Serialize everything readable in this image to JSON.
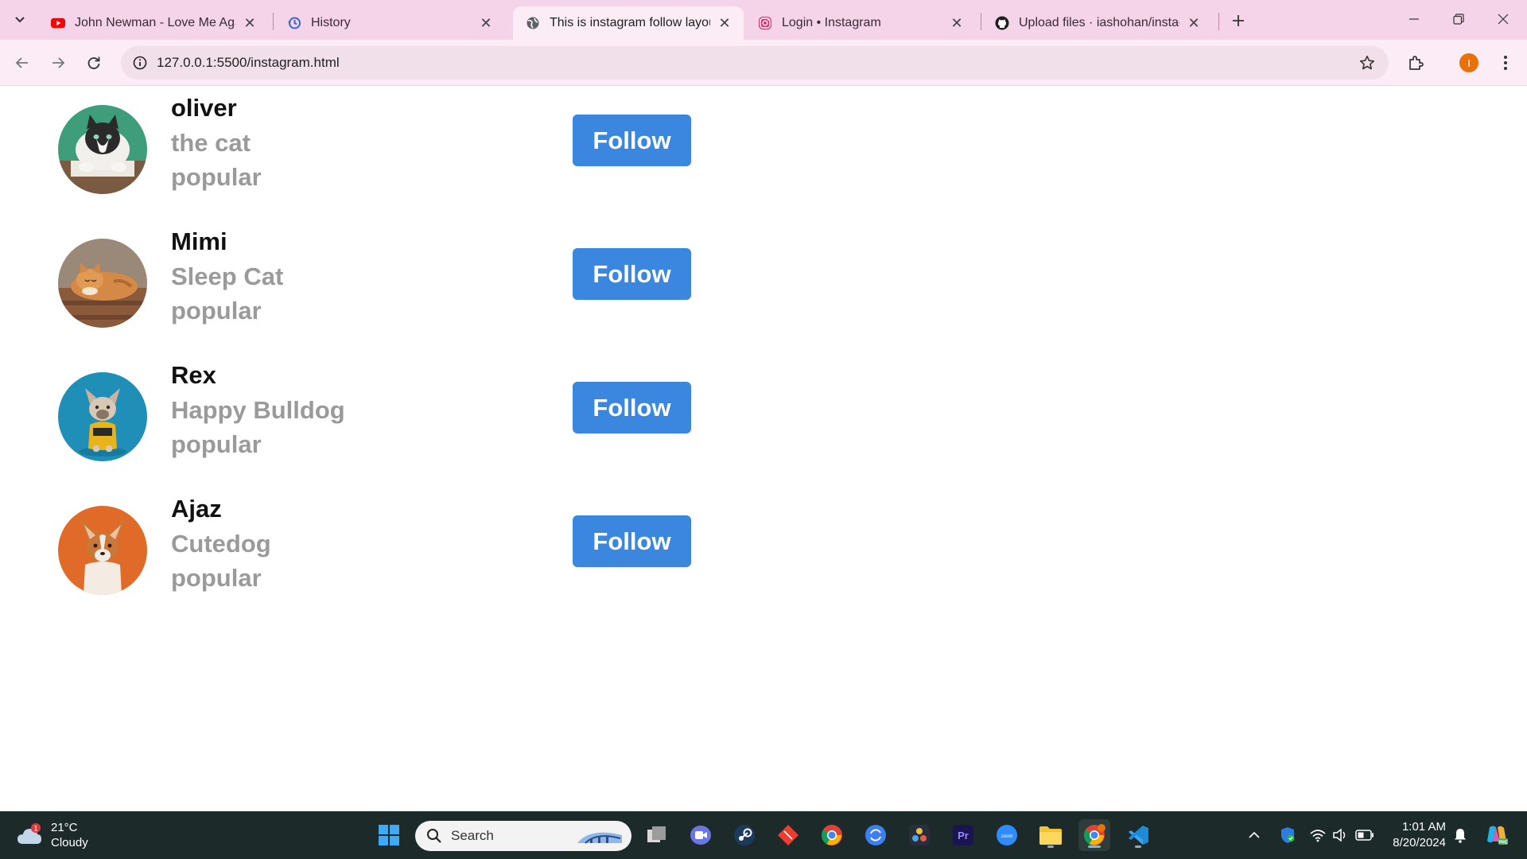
{
  "browser": {
    "tabs": [
      {
        "title": "John Newman - Love Me Again",
        "icon": "youtube-icon",
        "active": false
      },
      {
        "title": "History",
        "icon": "history-icon",
        "active": false
      },
      {
        "title": "This is instagram follow layout",
        "icon": "globe-icon",
        "active": true
      },
      {
        "title": "Login • Instagram",
        "icon": "instagram-icon",
        "active": false
      },
      {
        "title": "Upload files · iashohan/instagra",
        "icon": "github-icon",
        "active": false
      }
    ],
    "url": "127.0.0.1:5500/instagram.html",
    "profile_initial": "I",
    "colors": {
      "tabstrip": "#f5d3e9",
      "toolbar": "#fbecf5",
      "omnibox": "#f1e0ea",
      "profile": "#e8710a"
    }
  },
  "page": {
    "cards": [
      {
        "name": "oliver",
        "line1": "the cat",
        "line2": "popular",
        "button": "Follow",
        "avatar": "cat-photo-icon"
      },
      {
        "name": "Mimi",
        "line1": "Sleep Cat",
        "line2": "popular",
        "button": "Follow",
        "avatar": "orange-cat-photo-icon"
      },
      {
        "name": "Rex",
        "line1": "Happy Bulldog",
        "line2": "popular",
        "button": "Follow",
        "avatar": "bulldog-photo-icon"
      },
      {
        "name": "Ajaz",
        "line1": "Cutedog",
        "line2": "popular",
        "button": "Follow",
        "avatar": "corgi-photo-icon"
      }
    ],
    "colors": {
      "button": "#3b87e0",
      "subtext": "#9a9a9a",
      "name": "#111111"
    }
  },
  "taskbar": {
    "weather": {
      "temp": "21°C",
      "condition": "Cloudy",
      "badge": "1"
    },
    "search_placeholder": "Search",
    "clock": {
      "time": "1:01 AM",
      "date": "8/20/2024"
    },
    "apps": [
      "windows-start-icon",
      "task-view-icon",
      "meet-icon",
      "steam-icon",
      "git-icon",
      "chrome-icon",
      "sync-icon",
      "davinci-icon",
      "premiere-icon",
      "zoom-icon",
      "file-explorer-icon",
      "chrome-active-icon",
      "vscode-icon"
    ]
  }
}
